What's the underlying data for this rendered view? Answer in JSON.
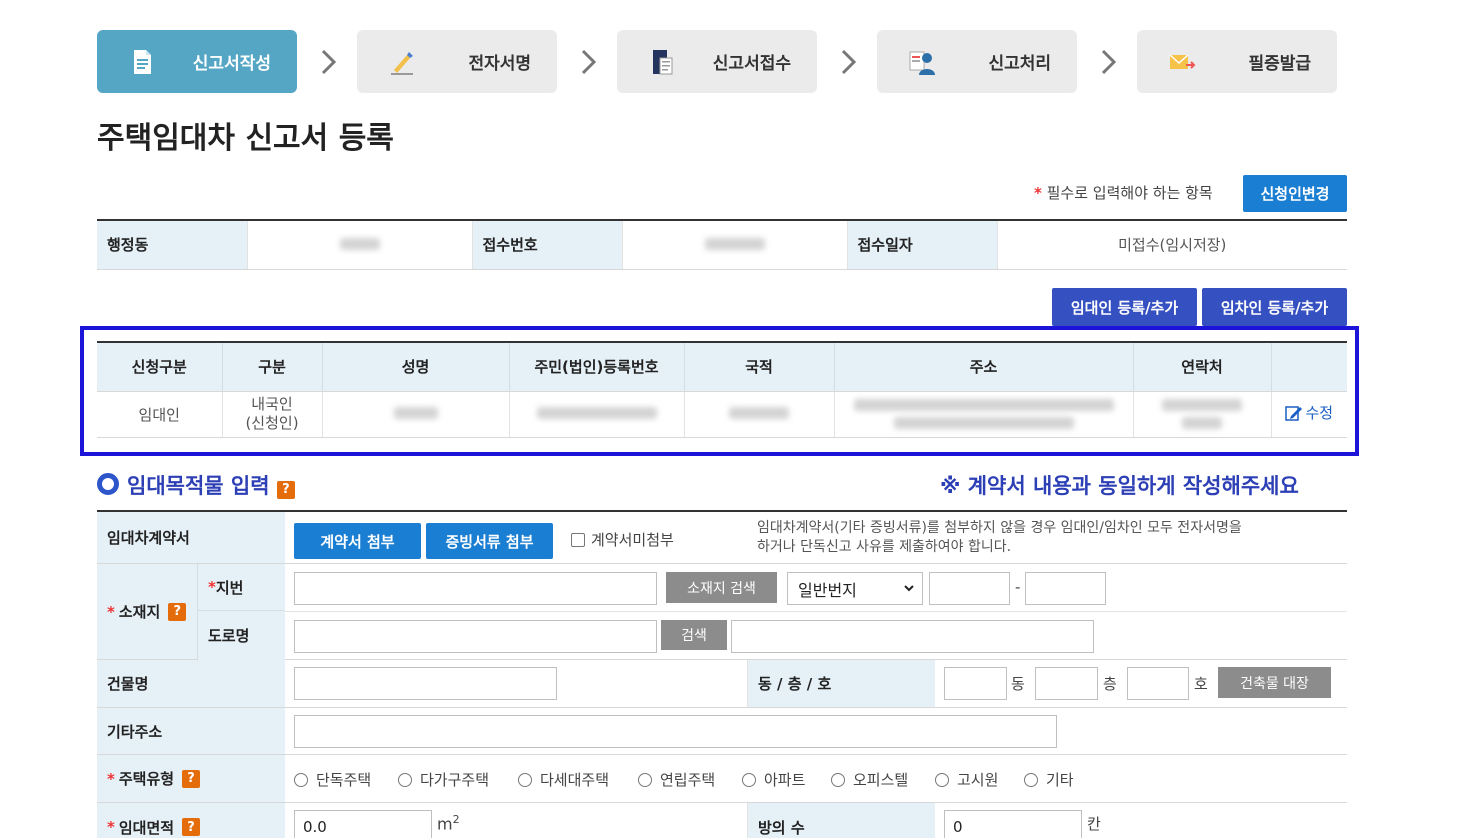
{
  "steps": [
    {
      "label": "신고서작성",
      "icon": "document-icon",
      "active": true
    },
    {
      "label": "전자서명",
      "icon": "pen-icon",
      "active": false
    },
    {
      "label": "신고서접수",
      "icon": "folder-doc-icon",
      "active": false
    },
    {
      "label": "신고처리",
      "icon": "person-card-icon",
      "active": false
    },
    {
      "label": "필증발급",
      "icon": "mail-send-icon",
      "active": false
    }
  ],
  "page_title": "주택임대차 신고서 등록",
  "required_note": {
    "star": "*",
    "text": " 필수로 입력해야 하는 항목"
  },
  "buttons": {
    "change_applicant": "신청인변경",
    "add_lessor": "임대인 등록/추가",
    "add_lessee": "임차인 등록/추가",
    "attach_contract": "계약서 첨부",
    "attach_evidence": "증빙서류 첨부",
    "search_location": "소재지 검색",
    "search": "검색",
    "building_register": "건축물 대장"
  },
  "info": {
    "admin_dong_label": "행정동",
    "receipt_no_label": "접수번호",
    "receipt_date_label": "접수일자",
    "receipt_date_value": "미접수(임시저장)"
  },
  "party_table": {
    "headers": [
      "신청구분",
      "구분",
      "성명",
      "주민(법인)등록번호",
      "국적",
      "주소",
      "연락처",
      ""
    ],
    "row": {
      "type": "임대인",
      "category_line1": "내국인",
      "category_line2": "(신청인)",
      "edit": "수정"
    }
  },
  "section": {
    "title": "임대목적물 입력",
    "help": "?",
    "note": "※ 계약서 내용과 동일하게 작성해주세요"
  },
  "form": {
    "contract_label": "임대차계약서",
    "no_contract_label": "계약서미첨부",
    "contract_note_line1": "임대차계약서(기타 증빙서류)를 첨부하지 않을 경우 임대인/임차인 모두 전자서명을",
    "contract_note_line2": "하거나 단독신고 사유를 제출하여야 합니다.",
    "location_label": "소재지",
    "lot_label": "지번",
    "road_label": "도로명",
    "lot_type_selected": "일반번지",
    "dash": "-",
    "building_name_label": "건물명",
    "dong_floor_ho_label": "동 / 층 / 호",
    "dong_unit": "동",
    "floor_unit": "층",
    "ho_unit": "호",
    "other_address_label": "기타주소",
    "house_type_label": "주택유형",
    "house_types": [
      "단독주택",
      "다가구주택",
      "다세대주택",
      "연립주택",
      "아파트",
      "오피스텔",
      "고시원",
      "기타"
    ],
    "area_label": "임대면적",
    "area_value": "0.0",
    "area_unit": "m",
    "area_unit_sup": "2",
    "rooms_label": "방의 수",
    "rooms_value": "0",
    "rooms_unit": "칸",
    "required_star": "*"
  }
}
